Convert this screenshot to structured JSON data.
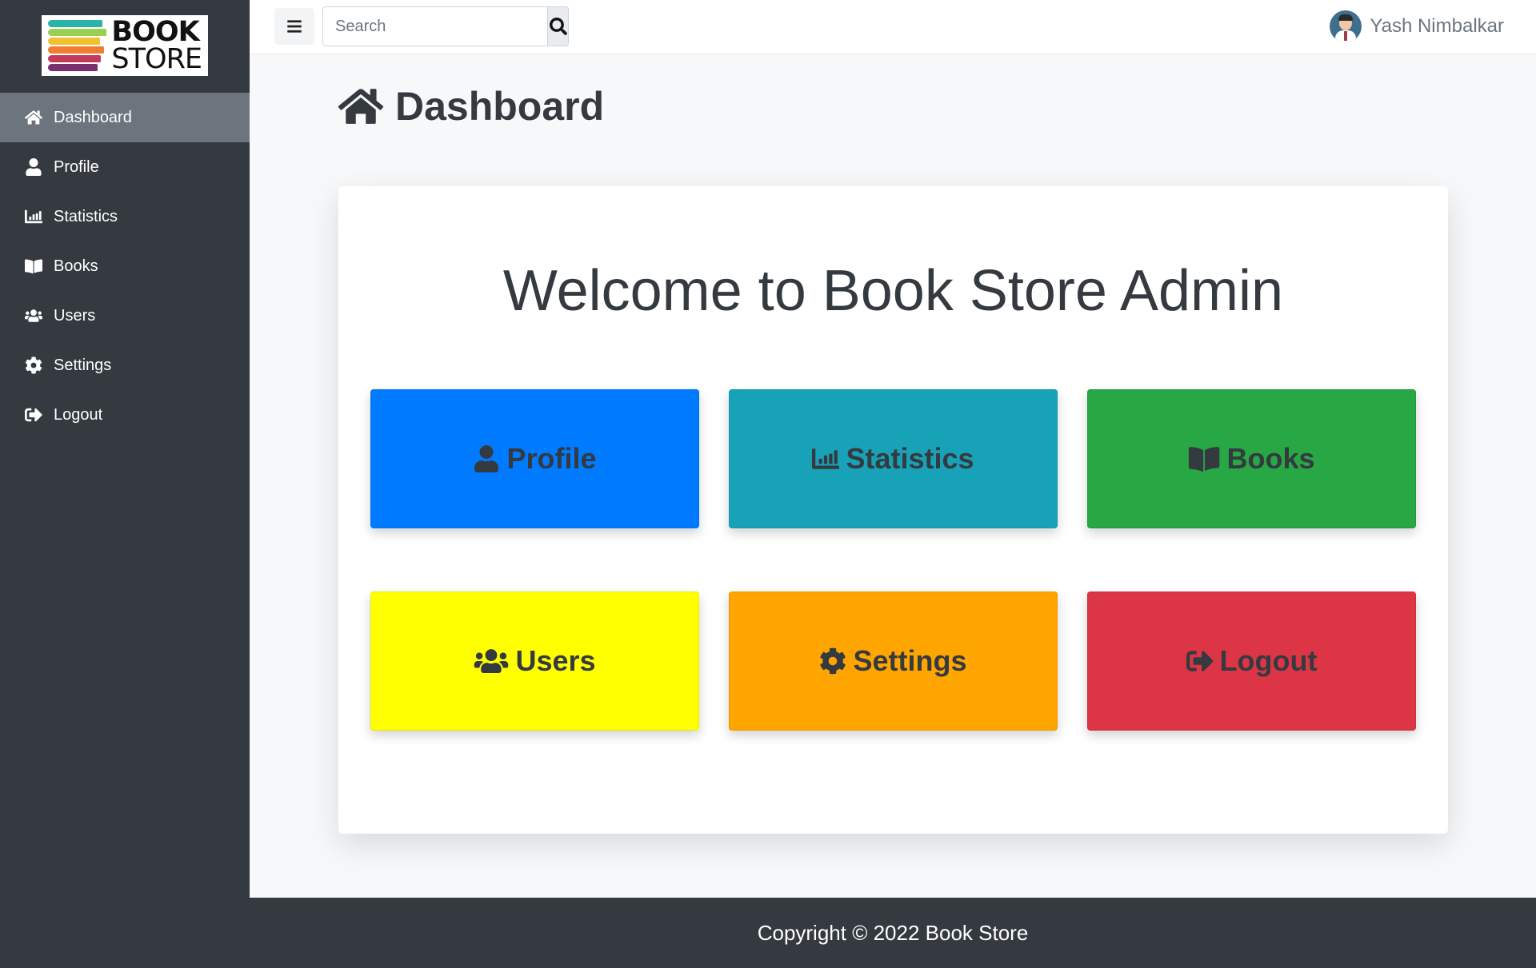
{
  "brand": {
    "logo_word1": "BOOK",
    "logo_word2": "STORE",
    "stripe_colors": [
      "#2bb3a8",
      "#9bcf53",
      "#f2c12e",
      "#ef7d32",
      "#c43a5b",
      "#7a2f6f"
    ]
  },
  "sidebar": {
    "items": [
      {
        "label": "Dashboard",
        "icon": "home-icon",
        "active": true
      },
      {
        "label": "Profile",
        "icon": "user-icon"
      },
      {
        "label": "Statistics",
        "icon": "bar-chart-icon"
      },
      {
        "label": "Books",
        "icon": "book-open-icon"
      },
      {
        "label": "Users",
        "icon": "users-icon"
      },
      {
        "label": "Settings",
        "icon": "gear-icon"
      },
      {
        "label": "Logout",
        "icon": "sign-out-icon"
      }
    ]
  },
  "topbar": {
    "menu_icon": "hamburger-icon",
    "search": {
      "placeholder": "Search",
      "value": "",
      "icon": "search-icon"
    },
    "user_name": "Yash Nimbalkar"
  },
  "page": {
    "title": "Dashboard",
    "title_icon": "home-icon"
  },
  "main": {
    "welcome": "Welcome to Book Store Admin",
    "tiles": [
      {
        "label": "Profile",
        "icon": "user-icon",
        "color": "#007bff"
      },
      {
        "label": "Statistics",
        "icon": "bar-chart-icon",
        "color": "#17a2b8"
      },
      {
        "label": "Books",
        "icon": "book-open-icon",
        "color": "#28a745"
      },
      {
        "label": "Users",
        "icon": "users-icon",
        "color": "#ffff00"
      },
      {
        "label": "Settings",
        "icon": "gear-icon",
        "color": "#ffa500"
      },
      {
        "label": "Logout",
        "icon": "sign-out-icon",
        "color": "#dc3545"
      }
    ]
  },
  "footer": {
    "text": "Copyright © 2022 Book Store"
  },
  "colors": {
    "sidebar_bg": "#343a40",
    "active_item_bg": "#6c757d",
    "page_bg": "#f7f8f9"
  }
}
